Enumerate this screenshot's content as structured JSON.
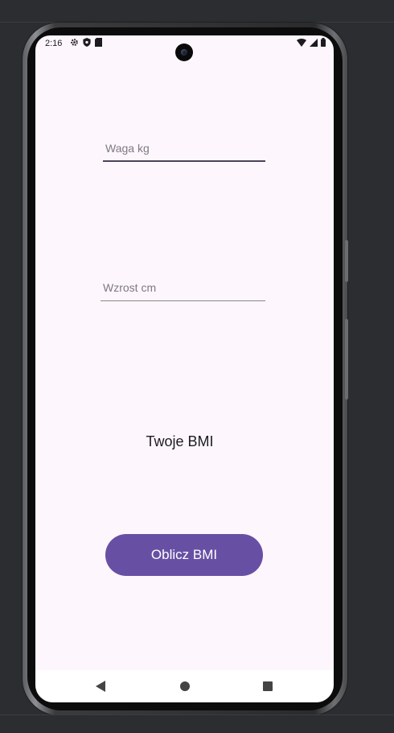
{
  "status_bar": {
    "time": "2:16",
    "left_icons": [
      "gear-icon",
      "shield-icon",
      "sd-card-icon"
    ],
    "right_icons": [
      "wifi-icon",
      "signal-icon",
      "battery-icon"
    ]
  },
  "form": {
    "weight_placeholder": "Waga kg",
    "weight_value": "",
    "height_placeholder": "Wzrost cm",
    "height_value": ""
  },
  "result": {
    "label": "Twoje BMI"
  },
  "actions": {
    "calculate_label": "Oblicz BMI"
  },
  "colors": {
    "background": "#fdf7fd",
    "button": "#6750a4",
    "button_text": "#ffffff",
    "text": "#1d1b20"
  },
  "nav_bar": {
    "icons": [
      "back-icon",
      "home-icon",
      "recents-icon"
    ]
  }
}
